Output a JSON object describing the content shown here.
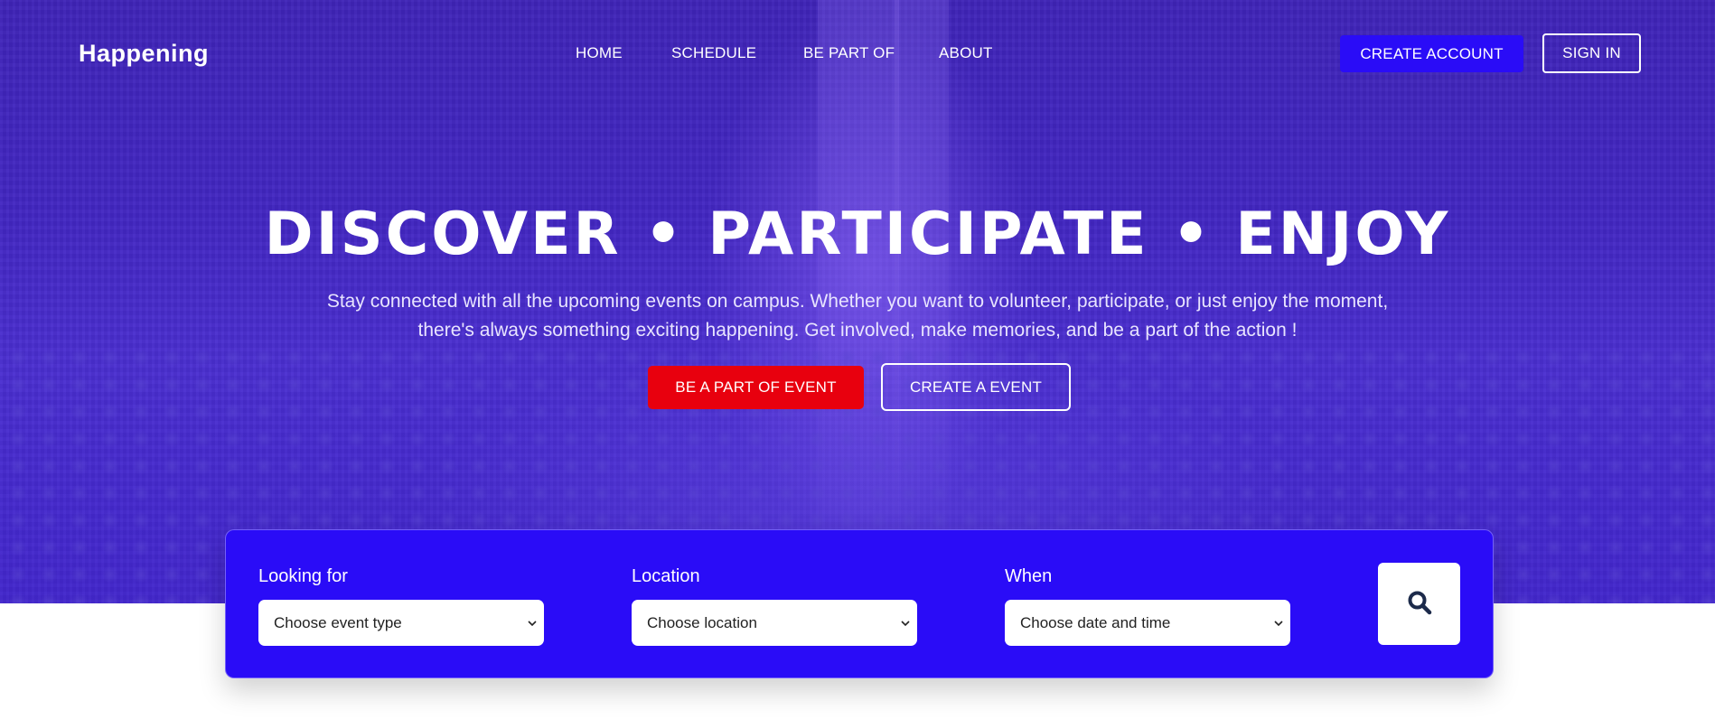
{
  "brand": {
    "logo": "Happening"
  },
  "nav": {
    "items": [
      "HOME",
      "SCHEDULE",
      "BE PART OF",
      "ABOUT"
    ],
    "create_account": "CREATE ACCOUNT",
    "sign_in": "SIGN IN"
  },
  "hero": {
    "headline": "DISCOVER • PARTICIPATE • ENJOY",
    "subtext_line1": "Stay connected with all the upcoming events on campus. Whether you want to volunteer, participate, or just enjoy the moment,",
    "subtext_line2": "there's always something exciting happening. Get involved, make memories, and be a part of the action !",
    "primary_cta": "BE A PART OF EVENT",
    "secondary_cta": "CREATE A EVENT"
  },
  "search": {
    "looking_for": {
      "label": "Looking for",
      "value": "Choose event type"
    },
    "location": {
      "label": "Location",
      "value": "Choose location"
    },
    "when": {
      "label": "When",
      "value": "Choose date and time"
    },
    "button_icon": "search-icon"
  },
  "colors": {
    "hero_bg": "#4226c2",
    "accent_blue": "#2a0cf7",
    "cta_red": "#e8000e",
    "search_icon": "#1c2a4a"
  }
}
